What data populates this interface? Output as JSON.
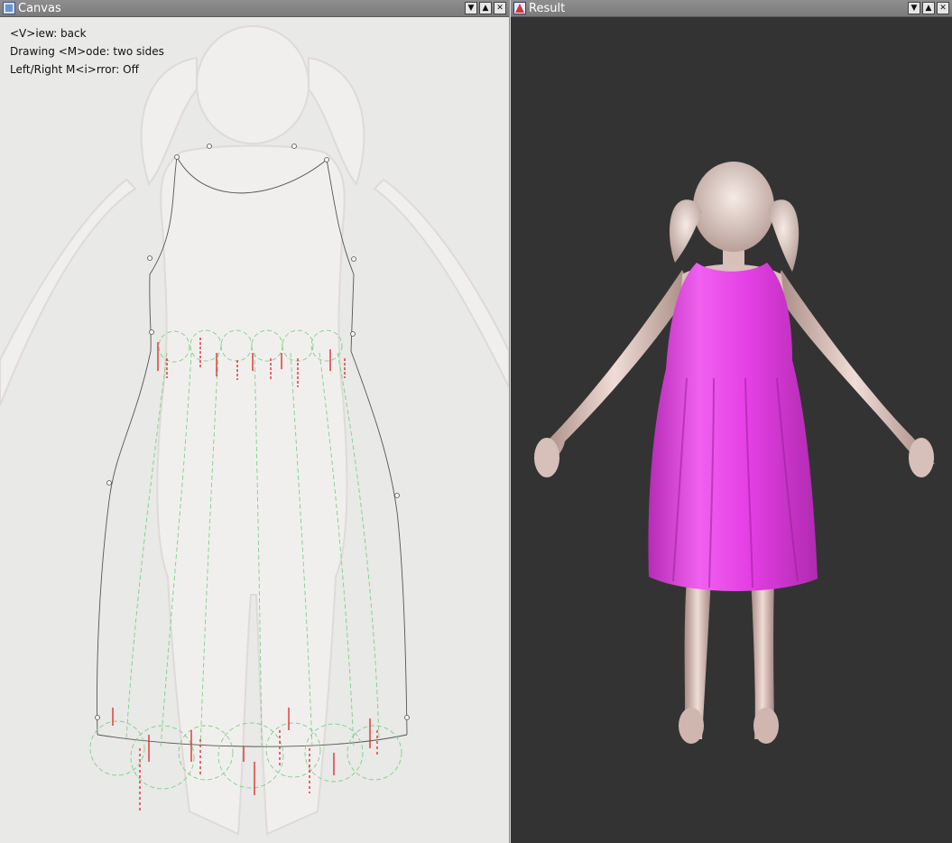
{
  "canvas_window": {
    "title": "Canvas",
    "overlay": {
      "view": "<V>iew: back",
      "mode": "Drawing <M>ode: two sides",
      "mirror": "Left/Right M<i>rror: Off"
    }
  },
  "result_window": {
    "title": "Result"
  },
  "window_buttons": {
    "minimize": "▼",
    "maximize": "▲",
    "close": "✕"
  },
  "icons": {
    "canvas_app_icon": "canvas-app-icon",
    "result_app_icon": "result-app-icon"
  },
  "colors": {
    "dress": "#e93ee9",
    "skin": "#dcc3bc",
    "result_bg": "#333333",
    "canvas_bg": "#e9e9e7",
    "stroke_green": "#7fcf8a",
    "stroke_red": "#e03030",
    "stroke_dark": "#555555"
  }
}
